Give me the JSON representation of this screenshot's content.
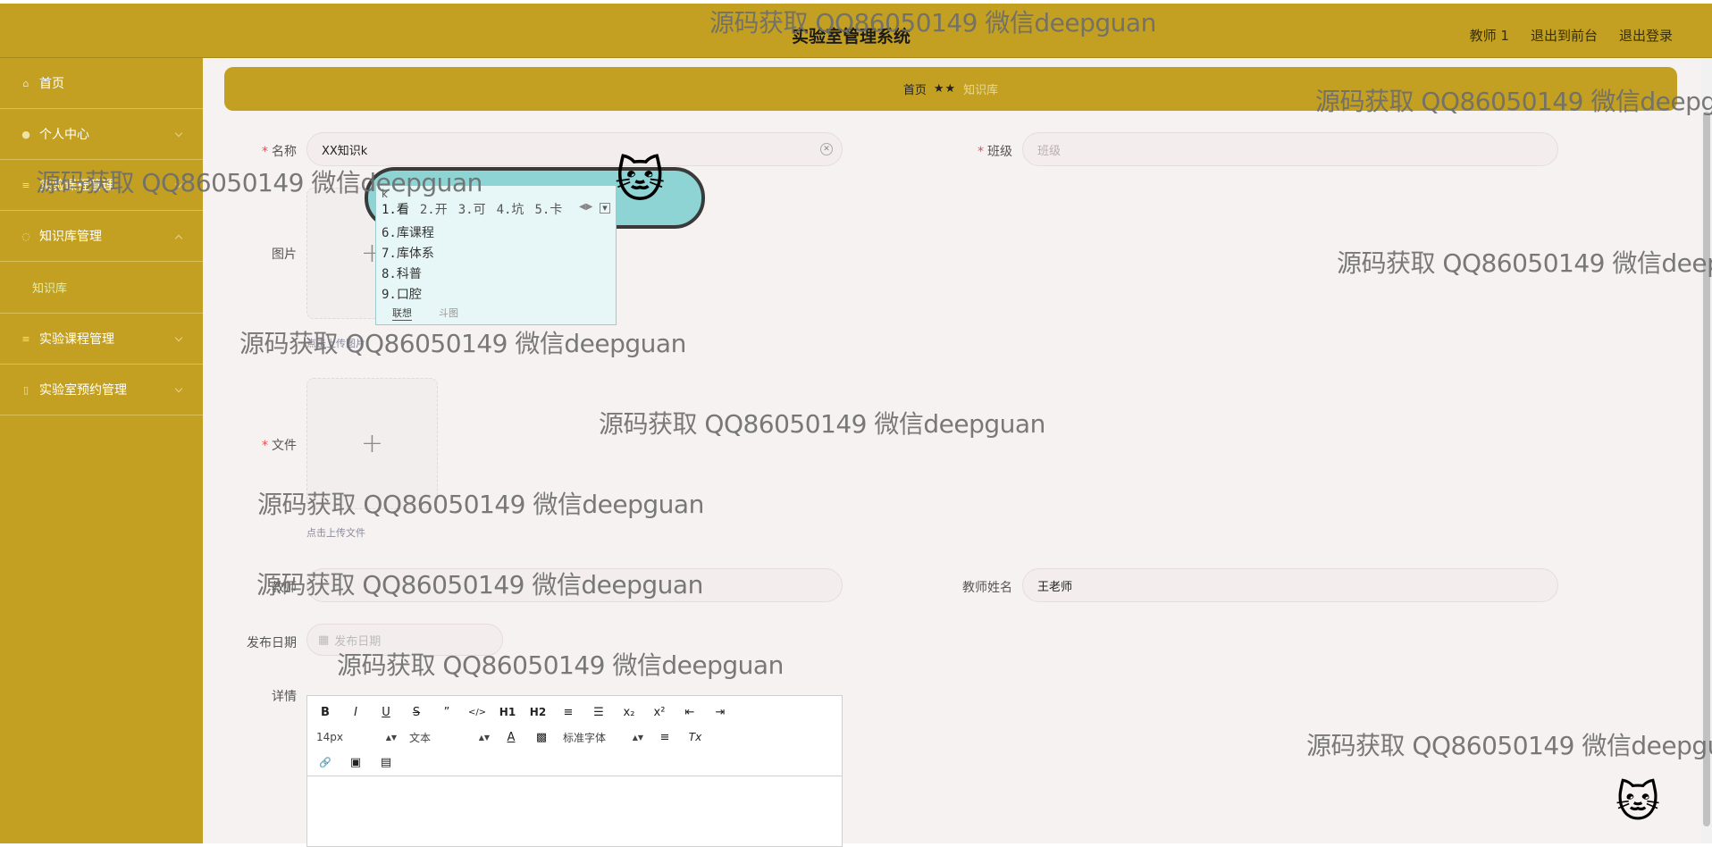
{
  "header": {
    "title": "实验室管理系统",
    "user_label": "教师 1",
    "front_link": "退出到前台",
    "logout_link": "退出登录"
  },
  "sidebar": {
    "items": [
      {
        "label": "首页"
      },
      {
        "label": "个人中心"
      },
      {
        "label": "实验课程管理"
      },
      {
        "label": "知识库管理"
      },
      {
        "label": "知识库"
      },
      {
        "label": "实验课程管理"
      },
      {
        "label": "实验室预约管理"
      }
    ]
  },
  "breadcrumb": {
    "home": "首页",
    "sep": "★★",
    "current": "知识库"
  },
  "form": {
    "name_label": "名称",
    "name_value": "XX知识k",
    "class_label": "班级",
    "class_placeholder": "班级",
    "image_label": "图片",
    "image_hint": "点击上传图片",
    "file_label": "文件",
    "file_hint": "点击上传文件",
    "teacher_account_label": "教师",
    "teacher_name_label": "教师姓名",
    "teacher_name_value": "王老师",
    "date_label": "发布日期",
    "date_placeholder": "发布日期",
    "detail_label": "详情"
  },
  "editor": {
    "row1": [
      "B",
      "I",
      "U",
      "S",
      "”",
      "</>",
      "H1",
      "H2",
      "≡",
      "☰",
      "x₂",
      "x²",
      "⇤",
      "⇥"
    ],
    "font_size": "14px",
    "text_type": "文本",
    "font_family": "标准字体",
    "align_icon": "≡",
    "clear_icon": "Tx",
    "row3": [
      "🔗",
      "▣",
      "▤"
    ]
  },
  "ime": {
    "code": "k",
    "candidates": [
      "1.看",
      "2.开",
      "3.可",
      "4.坑",
      "5.卡"
    ],
    "more": [
      "6.库课程",
      "7.库体系",
      "8.科普",
      "9.口腔"
    ],
    "tab_on": "联想",
    "tab_off": "斗图"
  },
  "watermark": {
    "text": "源码获取 QQ86050149 微信deepguan"
  }
}
